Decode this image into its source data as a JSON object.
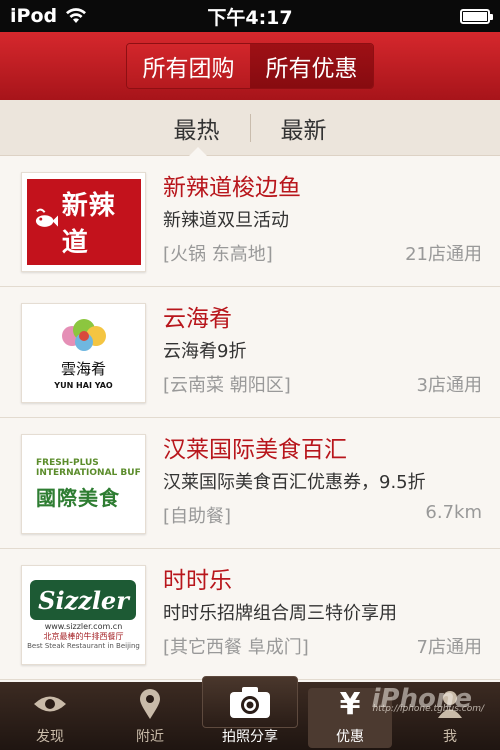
{
  "status_bar": {
    "carrier": "iPod",
    "time": "下午4:17"
  },
  "header": {
    "segments": [
      {
        "label": "所有团购",
        "active": false
      },
      {
        "label": "所有优惠",
        "active": true
      }
    ]
  },
  "subtabs": [
    {
      "label": "最热",
      "active": true
    },
    {
      "label": "最新",
      "active": false
    }
  ],
  "deals": [
    {
      "title": "新辣道梭边鱼",
      "desc": "新辣道双旦活动",
      "tag": "[火锅 东高地]",
      "meta": "21店通用",
      "logo_text": "新辣道"
    },
    {
      "title": "云海肴",
      "desc": "云海肴9折",
      "tag": "[云南菜 朝阳区]",
      "meta": "3店通用",
      "logo_text": "雲海肴",
      "logo_sub": "YUN HAI YAO"
    },
    {
      "title": "汉莱国际美食百汇",
      "desc": "汉莱国际美食百汇优惠券，9.5折",
      "tag": "[自助餐]",
      "meta": "6.7km",
      "logo_line1": "FRESH-PLUS",
      "logo_line2": "INTERNATIONAL BUF",
      "logo_text": "國際美食"
    },
    {
      "title": "时时乐",
      "desc": "时时乐招牌组合周三特价享用",
      "tag": "[其它西餐 阜成门]",
      "meta": "7店通用",
      "logo_text": "Sizzler",
      "logo_url": "www.sizzler.com.cn",
      "logo_cn": "北京最棒的牛排西餐厅",
      "logo_en": "Best Steak Restaurant in Beijing"
    }
  ],
  "tabbar": {
    "items": [
      {
        "label": "发现",
        "icon": "eye-icon"
      },
      {
        "label": "附近",
        "icon": "location-pin-icon"
      },
      {
        "label": "拍照分享",
        "icon": "camera-icon"
      },
      {
        "label": "优惠",
        "icon": "yen-icon",
        "selected": true
      },
      {
        "label": "我",
        "icon": "user-icon"
      }
    ]
  },
  "watermark": {
    "brand": "iPhone",
    "url": "http://iphone.tgbus.com/"
  },
  "colors": {
    "brand_red": "#c3121c",
    "tab_bar": "#2a1d17",
    "list_bg": "#f9f6f2"
  }
}
